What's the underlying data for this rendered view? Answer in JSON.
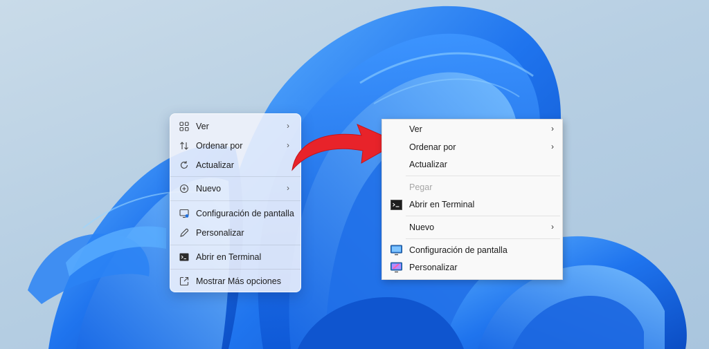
{
  "new_menu": {
    "items": [
      {
        "label": "Ver",
        "icon": "grid-icon",
        "submenu": true
      },
      {
        "label": "Ordenar por",
        "icon": "sort-arrows-icon",
        "submenu": true
      },
      {
        "label": "Actualizar",
        "icon": "refresh-icon",
        "submenu": false
      },
      {
        "label": "Nuevo",
        "icon": "plus-circle-icon",
        "submenu": true
      },
      {
        "label": "Configuración de pantalla",
        "icon": "display-settings-icon",
        "submenu": false
      },
      {
        "label": "Personalizar",
        "icon": "pencil-icon",
        "submenu": false
      },
      {
        "label": "Abrir en Terminal",
        "icon": "terminal-icon",
        "submenu": false
      },
      {
        "label": "Mostrar Más opciones",
        "icon": "external-link-icon",
        "submenu": false
      }
    ]
  },
  "old_menu": {
    "items": [
      {
        "label": "Ver",
        "submenu": true
      },
      {
        "label": "Ordenar por",
        "submenu": true
      },
      {
        "label": "Actualizar",
        "submenu": false
      },
      {
        "label": "Pegar",
        "disabled": true
      },
      {
        "label": "Abrir en Terminal",
        "icon": "terminal-icon"
      },
      {
        "label": "Nuevo",
        "submenu": true
      },
      {
        "label": "Configuración de pantalla",
        "icon": "monitor-icon"
      },
      {
        "label": "Personalizar",
        "icon": "personalize-icon"
      }
    ]
  },
  "chevron": "›",
  "colors": {
    "arrow": "#e8232a",
    "wallpaper_blue": "#1565e0",
    "wallpaper_light": "#3f9bff",
    "background": "#b7cfe3"
  }
}
